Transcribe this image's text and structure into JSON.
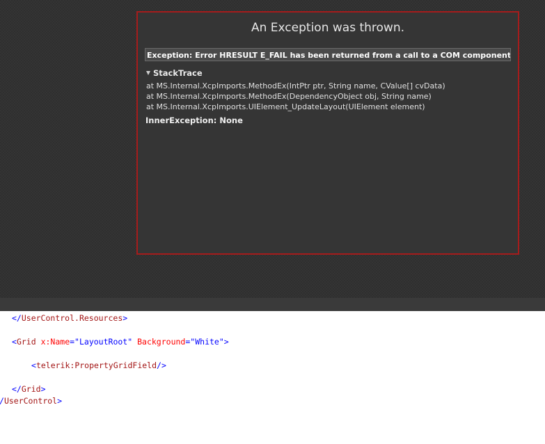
{
  "dialog": {
    "title": "An Exception was thrown.",
    "exception_message": "Exception: Error HRESULT E_FAIL has been returned from a call to a COM component.",
    "stacktrace_label": "StackTrace",
    "stacktrace_lines": [
      "at MS.Internal.XcpImports.MethodEx(IntPtr ptr, String name, CValue[] cvData)",
      "at MS.Internal.XcpImports.MethodEx(DependencyObject obj, String name)",
      "at MS.Internal.XcpImports.UIElement_UpdateLayout(UIElement element)"
    ],
    "inner_exception": "InnerException: None",
    "border_color": "#a61c1c"
  },
  "code_editor": {
    "line1": {
      "open": "</",
      "tag": "UserControl.Resources",
      "close": ">"
    },
    "line2": {
      "open": "<",
      "tag": "Grid",
      "space": " ",
      "attr1": "x:Name",
      "eq1": "=\"",
      "val1": "LayoutRoot",
      "q1": "\"",
      "sp2": " ",
      "attr2": "Background",
      "eq2": "=\"",
      "val2": "White",
      "q2": "\"",
      "close": ">"
    },
    "line3": {
      "open": "<",
      "tag": "telerik:PropertyGridField",
      "close": "/>"
    },
    "line4": {
      "open": "</",
      "tag": "Grid",
      "close": ">"
    },
    "line5": {
      "open": "/",
      "tag": "UserControl",
      "close": ">"
    }
  },
  "colors": {
    "xml_punctuation": "#0000ff",
    "xml_tag": "#a31515",
    "xml_attribute": "#ff0000",
    "xml_value": "#0000ff"
  }
}
